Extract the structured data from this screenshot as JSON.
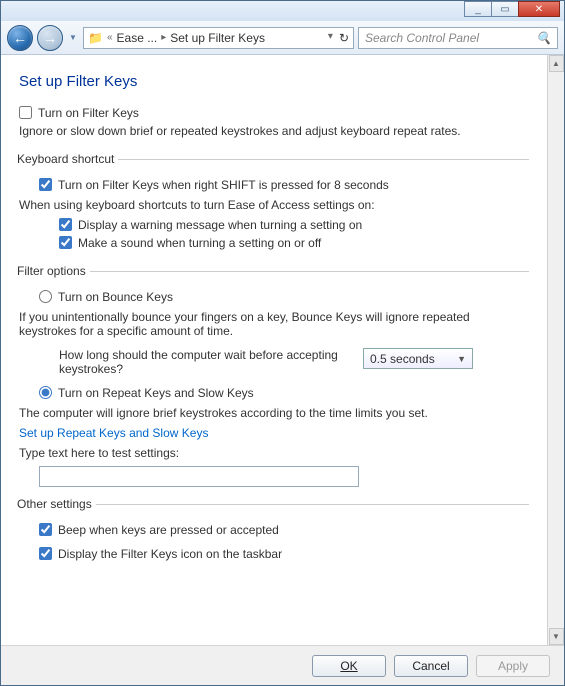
{
  "titlebar": {
    "min": "_",
    "max": "▭",
    "close": "✕"
  },
  "nav": {
    "back": "←",
    "fwd": "→",
    "crumbs": {
      "sep": "«",
      "seg1": "Ease ...",
      "chev": "▸",
      "seg2": "Set up Filter Keys"
    },
    "refresh": "↻",
    "search_placeholder": "Search Control Panel"
  },
  "page": {
    "title": "Set up Filter Keys",
    "turn_on_label": "Turn on Filter Keys",
    "turn_on_checked": false,
    "turn_on_desc": "Ignore or slow down brief or repeated keystrokes and adjust keyboard repeat rates."
  },
  "shortcut": {
    "legend": "Keyboard shortcut",
    "enable_label": "Turn on Filter Keys when right SHIFT is pressed for 8 seconds",
    "enable_checked": true,
    "sub_heading": "When using keyboard shortcuts to turn Ease of Access settings on:",
    "warn_label": "Display a warning message when turning a setting on",
    "warn_checked": true,
    "sound_label": "Make a sound when turning a setting on or off",
    "sound_checked": true
  },
  "filter": {
    "legend": "Filter options",
    "bounce_label": "Turn on Bounce Keys",
    "bounce_selected": false,
    "bounce_desc": "If you unintentionally bounce your fingers on a key, Bounce Keys will ignore repeated keystrokes for a specific amount of time.",
    "bounce_q": "How long should the computer wait before accepting keystrokes?",
    "bounce_wait": "0.5 seconds",
    "repeat_label": "Turn on Repeat Keys and Slow Keys",
    "repeat_selected": true,
    "repeat_desc": "The computer will ignore brief keystrokes according to the time limits you set.",
    "repeat_link": "Set up Repeat Keys and Slow Keys",
    "test_label": "Type text here to test settings:",
    "test_value": ""
  },
  "other": {
    "legend": "Other settings",
    "beep_label": "Beep when keys are pressed or accepted",
    "beep_checked": true,
    "icon_label": "Display the Filter Keys icon on the taskbar",
    "icon_checked": true
  },
  "buttons": {
    "ok": "OK",
    "cancel": "Cancel",
    "apply": "Apply"
  }
}
